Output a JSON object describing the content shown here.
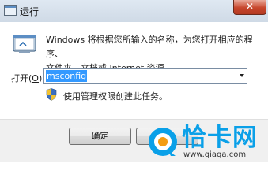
{
  "window": {
    "title": "运行",
    "close_glyph": "✕"
  },
  "dialog": {
    "description_line1": "Windows 将根据您所输入的名称，为您打开相应的程序、",
    "description_line2": "文件夹、文档或 Internet 资源。",
    "open_label_prefix": "打开(",
    "open_label_key": "O",
    "open_label_suffix": "):",
    "command_value": "msconfig",
    "admin_note": "使用管理权限创建此任务。"
  },
  "buttons": {
    "ok_label": "确定",
    "cancel_label": ""
  },
  "watermark": {
    "brand": "恰卡网",
    "url": "www.qiaqa.com"
  },
  "icons": {
    "title": "run-icon",
    "app": "run-program-icon",
    "shield": "uac-shield-icon",
    "close": "close-icon",
    "dropdown": "chevron-down-icon"
  },
  "colors": {
    "selection": "#3399ff",
    "close_button": "#c7462c",
    "watermark_blue": "#0aa0e8"
  }
}
